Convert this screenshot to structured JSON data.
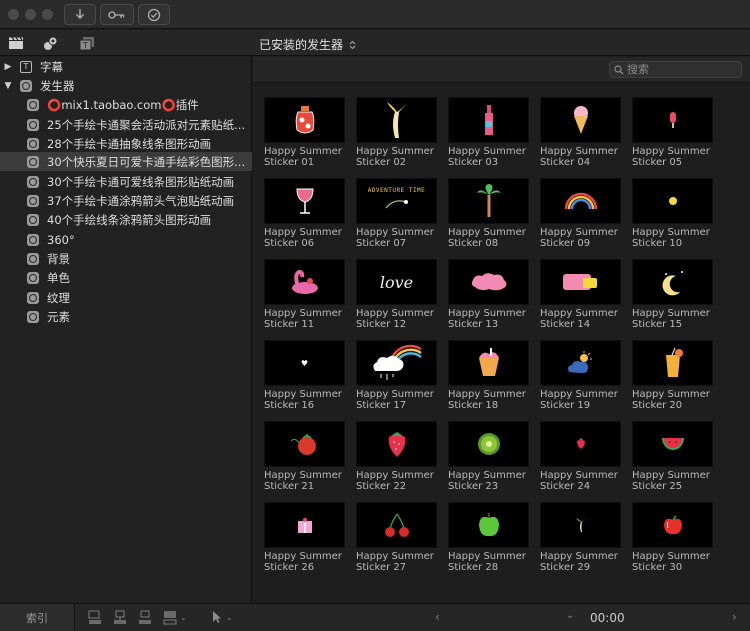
{
  "toolbar": {
    "library_title": "已安装的发生器"
  },
  "search": {
    "placeholder": "搜索"
  },
  "sidebar": {
    "items": [
      {
        "label": "字幕"
      },
      {
        "label": "发生器"
      },
      {
        "label": "⭕mix1.taobao.com⭕插件"
      },
      {
        "label": "25个手绘卡通聚会活动派对元素贴纸..."
      },
      {
        "label": "28个手绘卡通抽象线条图形动画"
      },
      {
        "label": "30个快乐夏日可爱卡通手绘彩色图形..."
      },
      {
        "label": "30个手绘卡通可爱线条图形贴纸动画"
      },
      {
        "label": "37个手绘卡通涂鸦箭头气泡贴纸动画"
      },
      {
        "label": "40个手绘线条涂鸦箭头图形动画"
      },
      {
        "label": "360°"
      },
      {
        "label": "背景"
      },
      {
        "label": "单色"
      },
      {
        "label": "纹理"
      },
      {
        "label": "元素"
      }
    ]
  },
  "tiles": [
    {
      "line1": "Happy Summer",
      "line2": "Sticker 01"
    },
    {
      "line1": "Happy Summer",
      "line2": "Sticker 02"
    },
    {
      "line1": "Happy Summer",
      "line2": "Sticker 03"
    },
    {
      "line1": "Happy Summer",
      "line2": "Sticker 04"
    },
    {
      "line1": "Happy Summer",
      "line2": "Sticker 05"
    },
    {
      "line1": "Happy Summer",
      "line2": "Sticker 06"
    },
    {
      "line1": "Happy Summer",
      "line2": "Sticker 07",
      "thumb_text": "ADVENTURE TIME"
    },
    {
      "line1": "Happy Summer",
      "line2": "Sticker 08"
    },
    {
      "line1": "Happy Summer",
      "line2": "Sticker 09"
    },
    {
      "line1": "Happy Summer",
      "line2": "Sticker 10"
    },
    {
      "line1": "Happy Summer",
      "line2": "Sticker 11"
    },
    {
      "line1": "Happy Summer",
      "line2": "Sticker 12",
      "thumb_text": "love"
    },
    {
      "line1": "Happy Summer",
      "line2": "Sticker 13"
    },
    {
      "line1": "Happy Summer",
      "line2": "Sticker 14"
    },
    {
      "line1": "Happy Summer",
      "line2": "Sticker 15"
    },
    {
      "line1": "Happy Summer",
      "line2": "Sticker 16"
    },
    {
      "line1": "Happy Summer",
      "line2": "Sticker 17"
    },
    {
      "line1": "Happy Summer",
      "line2": "Sticker 18"
    },
    {
      "line1": "Happy Summer",
      "line2": "Sticker 19"
    },
    {
      "line1": "Happy Summer",
      "line2": "Sticker 20"
    },
    {
      "line1": "Happy Summer",
      "line2": "Sticker 21"
    },
    {
      "line1": "Happy Summer",
      "line2": "Sticker 22"
    },
    {
      "line1": "Happy Summer",
      "line2": "Sticker 23"
    },
    {
      "line1": "Happy Summer",
      "line2": "Sticker 24"
    },
    {
      "line1": "Happy Summer",
      "line2": "Sticker 25"
    },
    {
      "line1": "Happy Summer",
      "line2": "Sticker 26"
    },
    {
      "line1": "Happy Summer",
      "line2": "Sticker 27"
    },
    {
      "line1": "Happy Summer",
      "line2": "Sticker 28"
    },
    {
      "line1": "Happy Summer",
      "line2": "Sticker 29"
    },
    {
      "line1": "Happy Summer",
      "line2": "Sticker 30"
    }
  ],
  "bottombar": {
    "index_label": "索引",
    "timecode": "00:00"
  }
}
